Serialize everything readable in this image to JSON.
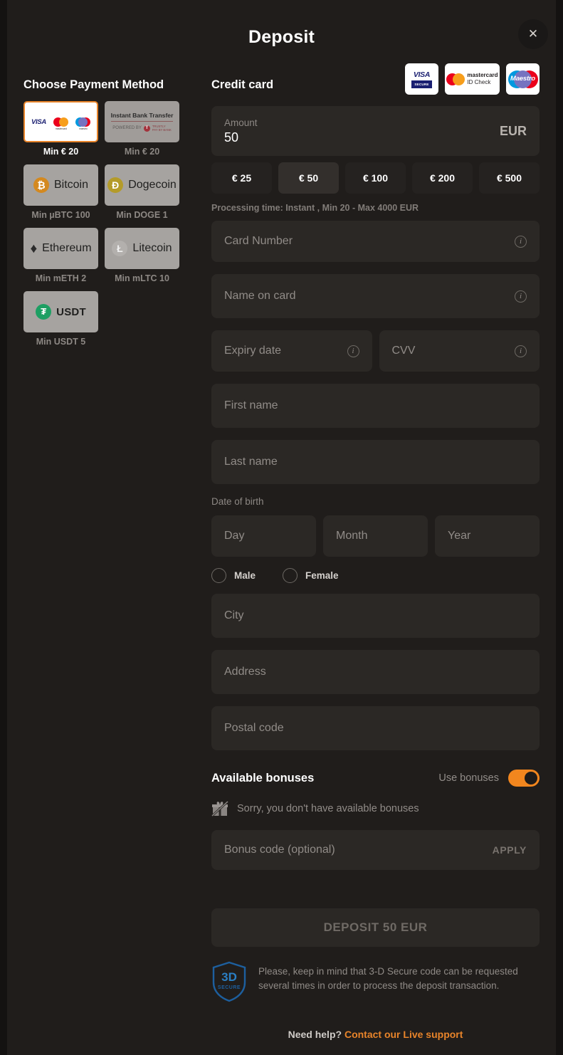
{
  "header": {
    "title": "Deposit",
    "close_label": "✕"
  },
  "left": {
    "heading": "Choose Payment Method",
    "methods": [
      {
        "id": "credit-card",
        "label": "",
        "min": "Min € 20",
        "selected": true,
        "kind": "cards"
      },
      {
        "id": "instant-bank-transfer",
        "label": "Instant Bank Transfer",
        "powered_by": "POWERED BY",
        "brand": "TRUSTLY\nPAY BY BANK",
        "min": "Min € 20",
        "selected": false,
        "kind": "bank"
      },
      {
        "id": "bitcoin",
        "label": "Bitcoin",
        "symbol": "₿",
        "min": "Min µBTC 100",
        "selected": false,
        "kind": "crypto"
      },
      {
        "id": "dogecoin",
        "label": "Dogecoin",
        "symbol": "Ð",
        "min": "Min DOGE 1",
        "selected": false,
        "kind": "crypto"
      },
      {
        "id": "ethereum",
        "label": "Ethereum",
        "symbol": "♦",
        "min": "Min mETH 2",
        "selected": false,
        "kind": "crypto"
      },
      {
        "id": "litecoin",
        "label": "Litecoin",
        "symbol": "Ł",
        "min": "Min mLTC 10",
        "selected": false,
        "kind": "crypto"
      },
      {
        "id": "usdt",
        "label": "USDT",
        "symbol": "₮",
        "min": "Min USDT 5",
        "selected": false,
        "kind": "crypto"
      }
    ]
  },
  "right": {
    "heading": "Credit card",
    "brand_logos": [
      {
        "id": "visa-secure",
        "line1": "VISA",
        "line2": "SECURE"
      },
      {
        "id": "mastercard-id-check",
        "line1": "mastercard",
        "line2": "ID Check"
      },
      {
        "id": "maestro",
        "line1": "Maestro",
        "line2": ""
      }
    ],
    "amount": {
      "label": "Amount",
      "value": "50",
      "currency": "EUR"
    },
    "quick_amounts": [
      {
        "label": "€ 25",
        "active": false
      },
      {
        "label": "€ 50",
        "active": true
      },
      {
        "label": "€ 100",
        "active": false
      },
      {
        "label": "€ 200",
        "active": false
      },
      {
        "label": "€ 500",
        "active": false
      }
    ],
    "processing_note": "Processing time: Instant , Min 20 - Max 4000 EUR",
    "fields": {
      "card_number": "Card Number",
      "name_on_card": "Name on card",
      "expiry_date": "Expiry date",
      "cvv": "CVV",
      "first_name": "First name",
      "last_name": "Last name",
      "dob_label": "Date of birth",
      "day": "Day",
      "month": "Month",
      "year": "Year",
      "city": "City",
      "address": "Address",
      "postal_code": "Postal code"
    },
    "gender": {
      "male": "Male",
      "female": "Female"
    },
    "bonuses": {
      "title": "Available bonuses",
      "use_label": "Use bonuses",
      "toggle_on": true,
      "empty_text": "Sorry, you don't have available bonuses",
      "code_placeholder": "Bonus code (optional)",
      "apply_label": "APPLY"
    },
    "deposit_button": "DEPOSIT 50 EUR",
    "secure_badge": {
      "line1": "3D",
      "line2": "SECURE"
    },
    "secure_note": "Please, keep in mind that 3-D Secure code can be requested several times in order to process the deposit transaction.",
    "help": {
      "prefix": "Need help? ",
      "link": "Contact our Live support"
    }
  },
  "colors": {
    "accent": "#e8842a",
    "toggle_on": "#f2861e",
    "modal_bg": "#201d1b",
    "field_bg": "#2b2825",
    "tile_bg": "#a6a3a0",
    "secure_blue": "#1d5f9e"
  }
}
